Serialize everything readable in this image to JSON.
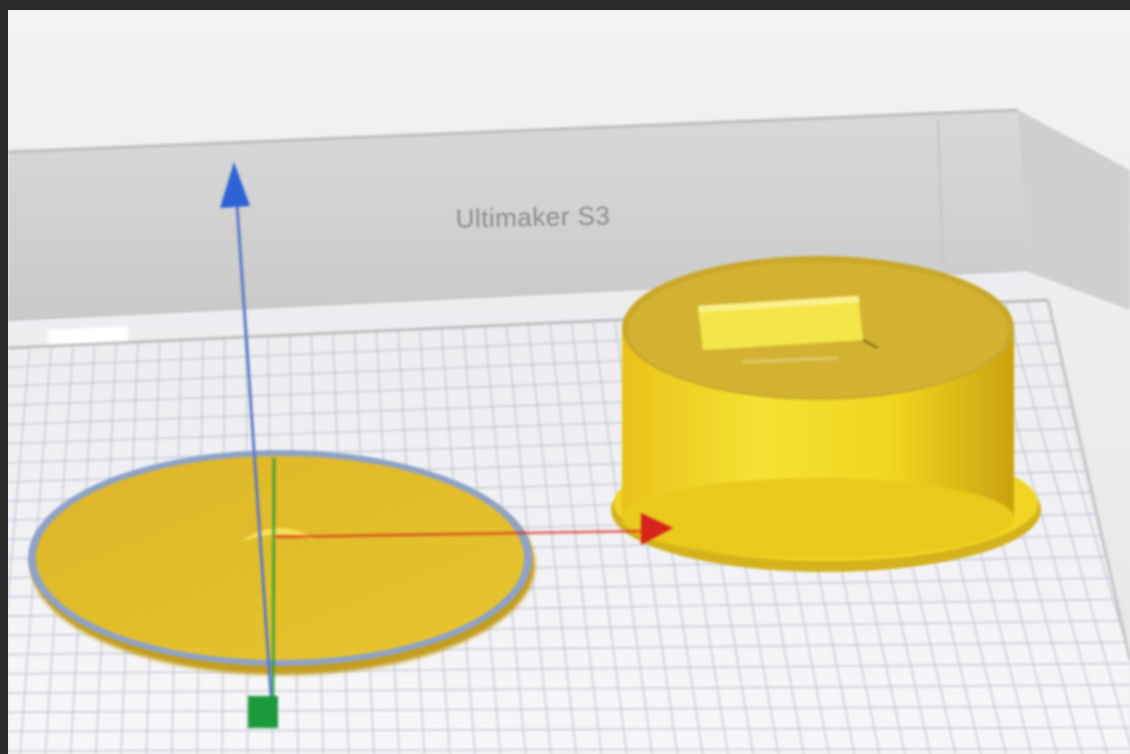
{
  "viewport": {
    "printer_name": "Ultimaker S3"
  },
  "axes": {
    "x_color": "#d8231b",
    "y_color": "#2f63d6",
    "z_color": "#1e9a3a"
  },
  "colors": {
    "model": "#f2d21c",
    "model_selected_outline": "#8fa2c8",
    "build_plate": "#f4f4f6",
    "grid_line": "#c9ccd6",
    "wall": "#dcdcdc"
  },
  "objects": [
    {
      "name": "flat-disc",
      "selected": true
    },
    {
      "name": "cylinder-with-tab",
      "selected": false
    }
  ]
}
